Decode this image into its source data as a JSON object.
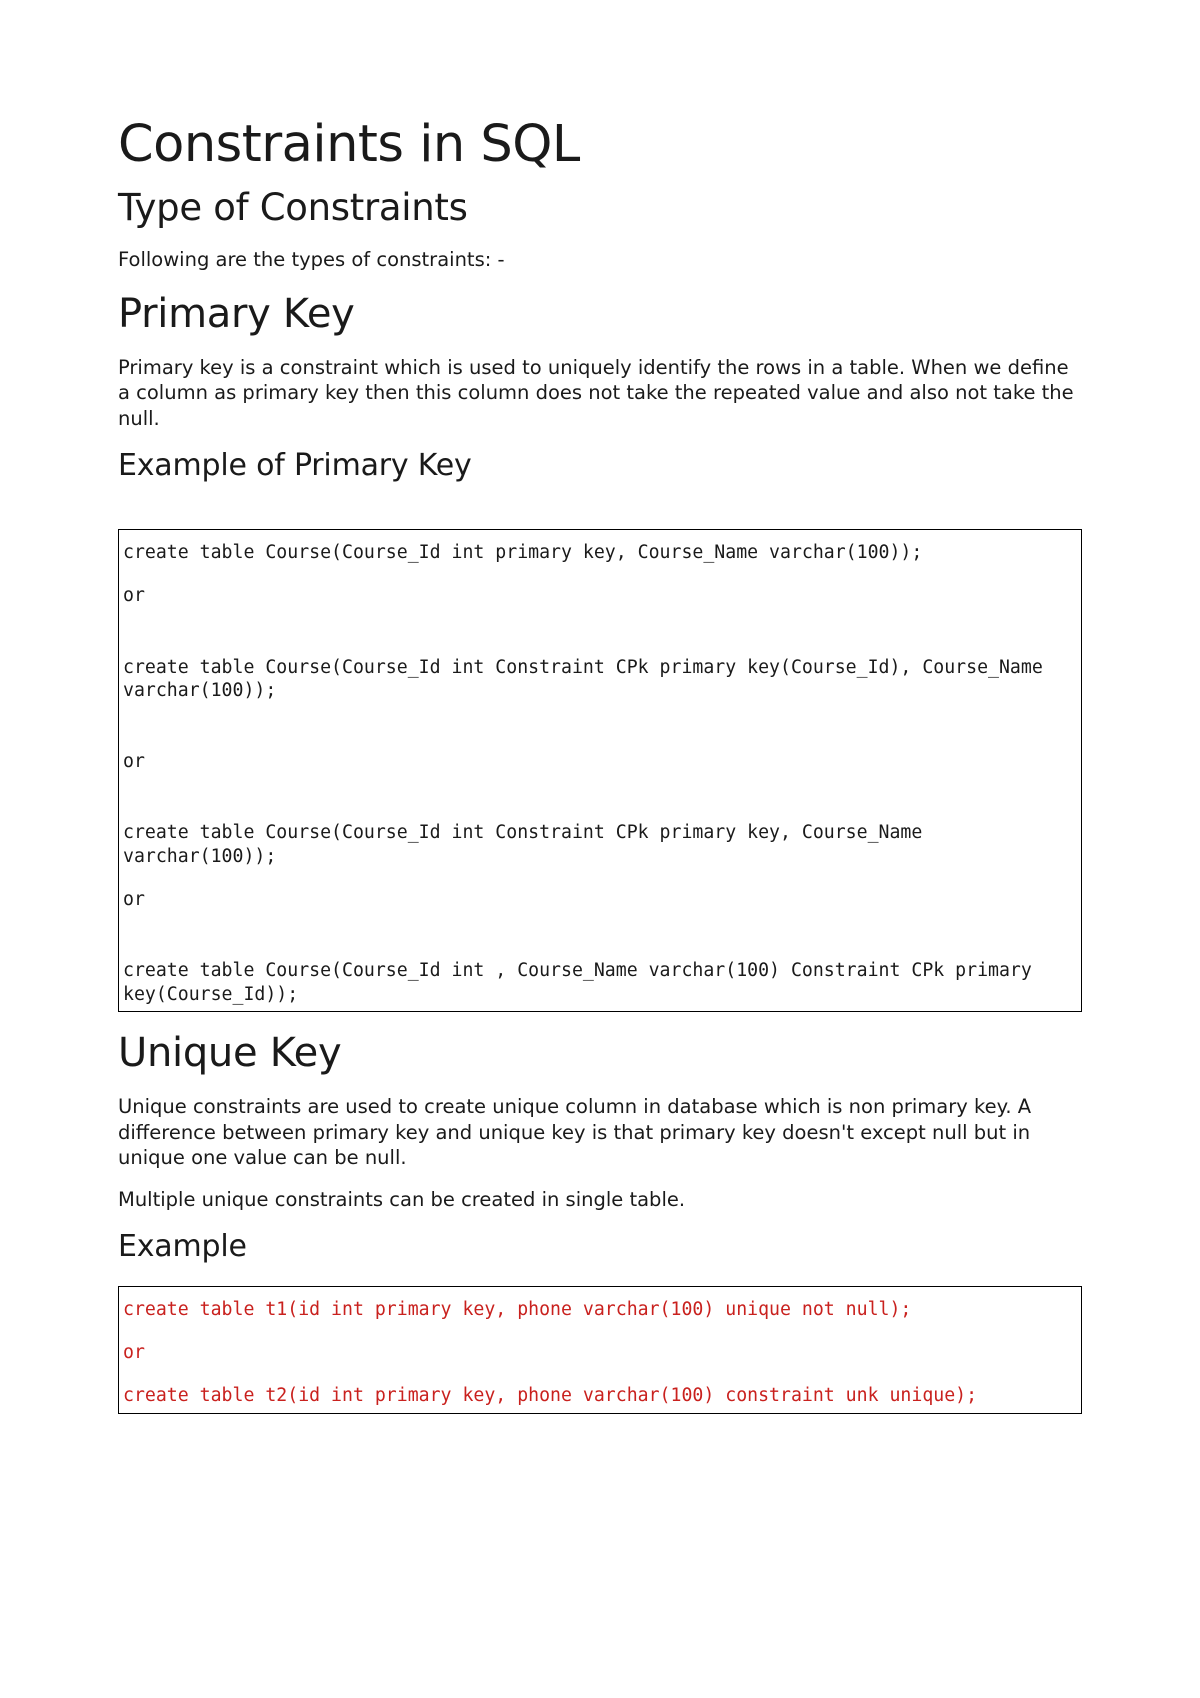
{
  "title": "Constraints in SQL",
  "subtitle": "Type of Constraints",
  "intro": "Following are the types of constraints: -",
  "primary_key": {
    "heading": "Primary Key",
    "para": "Primary key is a constraint which is used to uniquely identify the rows in a table. When we define a column as primary key then this column does not take the repeated value and also not take the null.",
    "example_heading": "Example of Primary Key",
    "code": {
      "l1": "create table Course(Course_Id int primary key, Course_Name varchar(100));",
      "l2": "or",
      "l3": "create table Course(Course_Id int Constraint CPk primary key(Course_Id), Course_Name varchar(100));",
      "l4": "or",
      "l5": "create table Course(Course_Id int Constraint CPk primary key, Course_Name varchar(100));",
      "l6": "or",
      "l7": "create table Course(Course_Id int , Course_Name varchar(100) Constraint CPk primary key(Course_Id));"
    }
  },
  "unique_key": {
    "heading": "Unique Key",
    "para1": "Unique constraints are used to create unique column in database which is non primary key. A difference between primary key and unique key is that primary key doesn't except null but in unique one value can be null.",
    "para2": "Multiple unique constraints can be created in single table.",
    "example_heading": "Example",
    "code": {
      "l1": "create table t1(id int primary key, phone varchar(100) unique not null);",
      "l2": "or",
      "l3": "create table t2(id int primary key, phone varchar(100) constraint unk unique);"
    }
  }
}
